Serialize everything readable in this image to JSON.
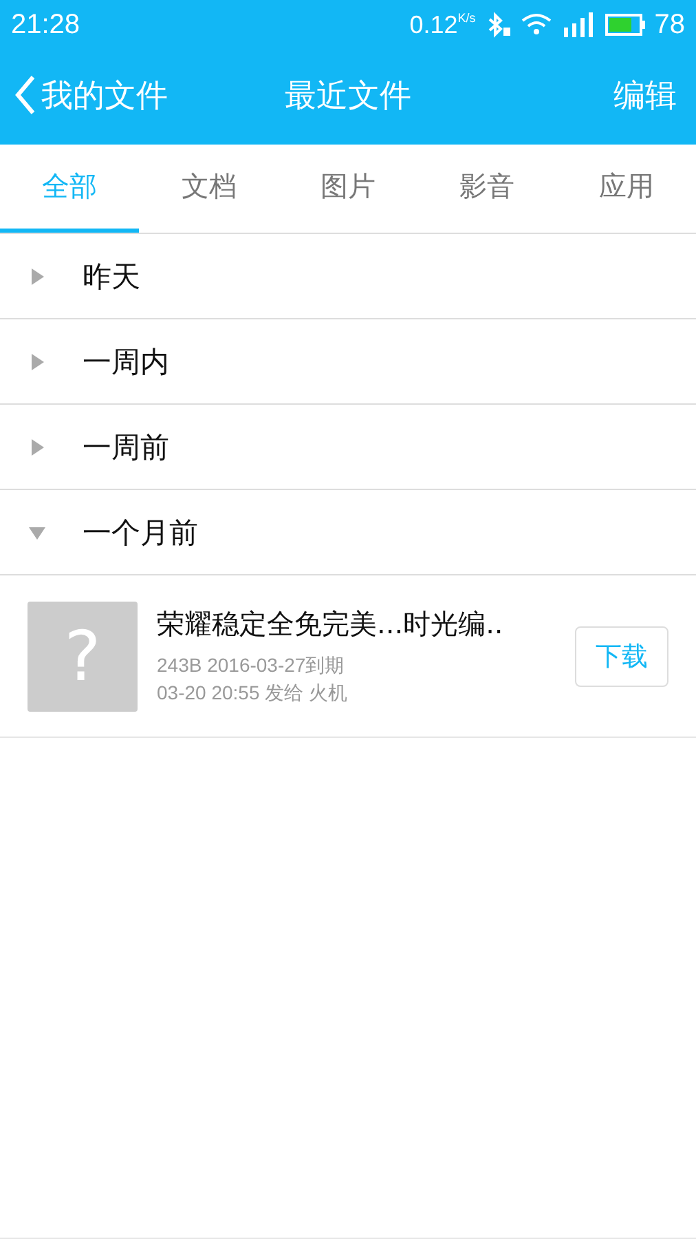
{
  "status_bar": {
    "time": "21:28",
    "speed": "0.12",
    "speed_unit": "K/s",
    "battery": "78"
  },
  "header": {
    "back": "我的文件",
    "title": "最近文件",
    "action": "编辑"
  },
  "tabs": [
    {
      "label": "全部",
      "selected": true
    },
    {
      "label": "文档",
      "selected": false
    },
    {
      "label": "图片",
      "selected": false
    },
    {
      "label": "影音",
      "selected": false
    },
    {
      "label": "应用",
      "selected": false
    }
  ],
  "groups": [
    {
      "label": "昨天",
      "expanded": false
    },
    {
      "label": "一周内",
      "expanded": false
    },
    {
      "label": "一周前",
      "expanded": false
    },
    {
      "label": "一个月前",
      "expanded": true,
      "files": [
        {
          "thumbnail_glyph": "?",
          "name": "荣耀稳定全免完美...时光编..",
          "meta": "243B  2016-03-27到期",
          "sent": "03-20 20:55  发给 火机",
          "button": "下载"
        }
      ]
    }
  ]
}
